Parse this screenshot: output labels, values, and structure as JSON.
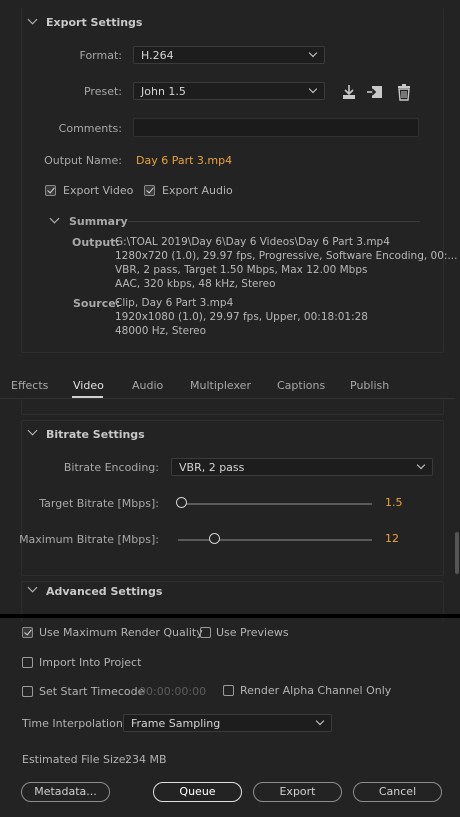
{
  "export_settings": {
    "title": "Export Settings",
    "format_label": "Format:",
    "format_value": "H.264",
    "preset_label": "Preset:",
    "preset_value": "John 1.5",
    "comments_label": "Comments:",
    "comments_value": "",
    "output_name_label": "Output Name:",
    "output_name_value": "Day 6 Part 3.mp4",
    "export_video_label": "Export Video",
    "export_video_checked": true,
    "export_audio_label": "Export Audio",
    "export_audio_checked": true,
    "summary_title": "Summary",
    "summary_output_label": "Output:",
    "summary_output_lines": [
      "G:\\TOAL 2019\\Day 6\\Day 6 Videos\\Day 6 Part 3.mp4",
      "1280x720 (1.0), 29.97 fps, Progressive, Software Encoding, 00:...",
      "VBR, 2 pass, Target 1.50 Mbps, Max 12.00 Mbps",
      "AAC, 320 kbps, 48 kHz, Stereo"
    ],
    "summary_source_label": "Source:",
    "summary_source_lines": [
      "Clip, Day 6 Part 3.mp4",
      "1920x1080 (1.0), 29.97 fps, Upper, 00:18:01:28",
      "48000 Hz, Stereo"
    ]
  },
  "tabs": [
    "Effects",
    "Video",
    "Audio",
    "Multiplexer",
    "Captions",
    "Publish"
  ],
  "active_tab": "Video",
  "bitrate": {
    "title": "Bitrate Settings",
    "encoding_label": "Bitrate Encoding:",
    "encoding_value": "VBR, 2 pass",
    "target_label": "Target Bitrate [Mbps]:",
    "target_value": "1.5",
    "max_label": "Maximum Bitrate [Mbps]:",
    "max_value": "12"
  },
  "advanced": {
    "title": "Advanced Settings"
  },
  "bottom": {
    "max_render_quality_label": "Use Maximum Render Quality",
    "max_render_quality_checked": true,
    "use_previews_label": "Use Previews",
    "use_previews_checked": false,
    "import_into_project_label": "Import Into Project",
    "import_into_project_checked": false,
    "set_start_timecode_label": "Set Start Timecode",
    "set_start_timecode_checked": false,
    "start_timecode_value": "00:00:00:00",
    "render_alpha_label": "Render Alpha Channel Only",
    "render_alpha_checked": false,
    "time_interp_label": "Time Interpolation:",
    "time_interp_value": "Frame Sampling",
    "file_size_label": "Estimated File Size:",
    "file_size_value": "234 MB"
  },
  "buttons": {
    "metadata": "Metadata...",
    "queue": "Queue",
    "export": "Export",
    "cancel": "Cancel"
  },
  "colors": {
    "accent_orange": "#e8a33a",
    "background": "#232323"
  }
}
